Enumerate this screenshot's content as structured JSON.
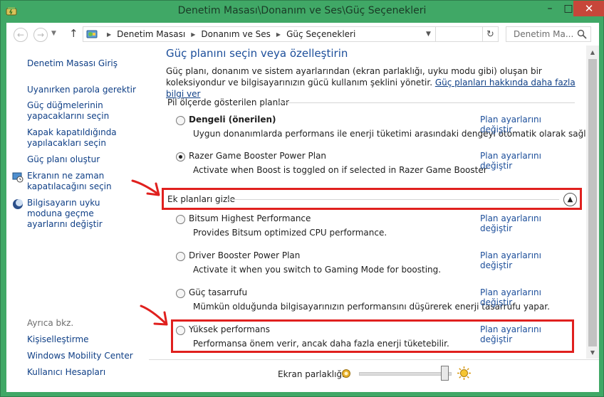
{
  "window": {
    "title": "Denetim Masası\\Donanım ve Ses\\Güç Seçenekleri",
    "caption": {
      "minimize": "–",
      "maximize": "□",
      "close": "✕"
    }
  },
  "address": {
    "breadcrumbs": [
      "Denetim Masası",
      "Donanım ve Ses",
      "Güç Seçenekleri"
    ],
    "search_placeholder": "Denetim Ma..."
  },
  "sidebar": {
    "items": [
      {
        "label": "Denetim Masası Giriş"
      },
      {
        "label": "Uyanırken parola gerektir"
      },
      {
        "label": "Güç düğmelerinin yapacaklarını seçin"
      },
      {
        "label": "Kapak kapatıldığında yapılacakları seçin"
      },
      {
        "label": "Güç planı oluştur"
      },
      {
        "label": "Ekranın ne zaman kapatılacağını seçin"
      },
      {
        "label": "Bilgisayarın uyku moduna geçme ayarlarını değiştir"
      }
    ],
    "see_also_label": "Ayrıca bkz.",
    "see_also": [
      {
        "label": "Kişiselleştirme"
      },
      {
        "label": "Windows Mobility Center"
      },
      {
        "label": "Kullanıcı Hesapları"
      }
    ]
  },
  "main": {
    "heading": "Güç planını seçin veya özelleştirin",
    "intro": "Güç planı, donanım ve sistem ayarlarından (ekran parlaklığı, uyku modu gibi) oluşan bir koleksiyondur ve bilgisayarınızın gücü kullanım şeklini yönetir.",
    "intro_link": "Güç planları hakkında daha fazla bilgi ver",
    "battery_group_title": "Pil ölçerde gösterilen planlar",
    "extra_group_title": "Ek planları gizle",
    "change_link": "Plan ayarlarını değiştir",
    "plans": [
      {
        "name": "Dengeli (önerilen)",
        "desc": "Uygun donanımlarda performans ile enerji tüketimi arasındaki dengeyi otomatik olarak sağlar.",
        "selected": false
      },
      {
        "name": "Razer Game Booster Power Plan",
        "desc": "Activate when Boost is toggled on if selected in Razer Game Booster",
        "selected": true
      },
      {
        "name": "Bitsum Highest Performance",
        "desc": "Provides Bitsum optimized CPU performance.",
        "selected": false
      },
      {
        "name": "Driver Booster Power Plan",
        "desc": "Activate it when you switch to Gaming Mode for boosting.",
        "selected": false
      },
      {
        "name": "Güç tasarrufu",
        "desc": "Mümkün olduğunda bilgisayarınızın performansını düşürerek enerji tasarrufu yapar.",
        "selected": false
      },
      {
        "name": "Yüksek performans",
        "desc": "Performansa önem verir, ancak daha fazla enerji tüketebilir.",
        "selected": false
      }
    ]
  },
  "footer": {
    "brightness_label": "Ekran parlaklığı:",
    "brightness_level": 0.93
  },
  "colors": {
    "window_frame": "#40a866",
    "link": "#1c4e9a",
    "annotation": "#e0201e"
  }
}
